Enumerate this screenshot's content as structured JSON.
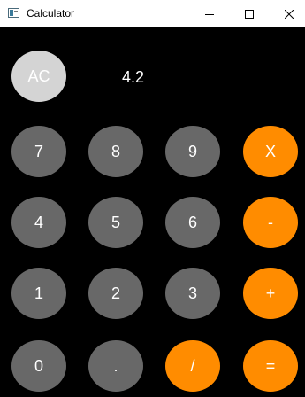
{
  "window": {
    "title": "Calculator"
  },
  "display": {
    "value": "4.2"
  },
  "buttons": {
    "clear": "AC",
    "seven": "7",
    "eight": "8",
    "nine": "9",
    "multiply": "X",
    "four": "4",
    "five": "5",
    "six": "6",
    "subtract": "-",
    "one": "1",
    "two": "2",
    "three": "3",
    "add": "+",
    "zero": "0",
    "decimal": ".",
    "divide": "/",
    "equals": "="
  },
  "icons": {
    "app": "calculator-app-icon",
    "minimize": "minimize-icon",
    "maximize": "maximize-icon",
    "close": "close-icon"
  },
  "colors": {
    "background": "#000000",
    "digit_button": "#686868",
    "operator_button": "#ff8c00",
    "clear_button": "#d4d4d4",
    "text": "#ffffff"
  }
}
